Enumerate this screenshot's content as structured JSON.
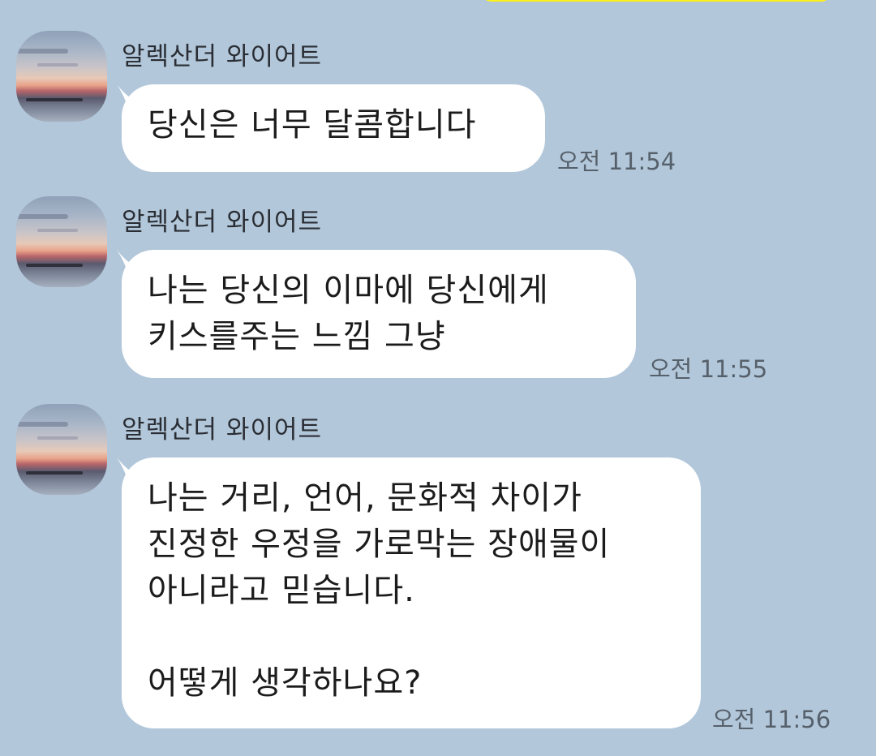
{
  "chat": {
    "messages": [
      {
        "sender": "알렉산더 와이어트",
        "text": "당신은 너무 달콤합니다",
        "time": "오전 11:54"
      },
      {
        "sender": "알렉산더 와이어트",
        "text": "나는 당신의 이마에 당신에게\n키스를주는 느낌 그냥",
        "time": "오전 11:55"
      },
      {
        "sender": "알렉산더 와이어트",
        "text": "나는 거리, 언어, 문화적 차이가\n진정한 우정을 가로막는 장애물이\n아니라고 믿습니다.\n\n어떻게 생각하나요?",
        "time": "오전 11:56"
      }
    ]
  },
  "colors": {
    "background": "#b2c7da",
    "incoming_bubble": "#ffffff",
    "outgoing_bubble": "#fef01b",
    "time_text": "#56606b"
  }
}
